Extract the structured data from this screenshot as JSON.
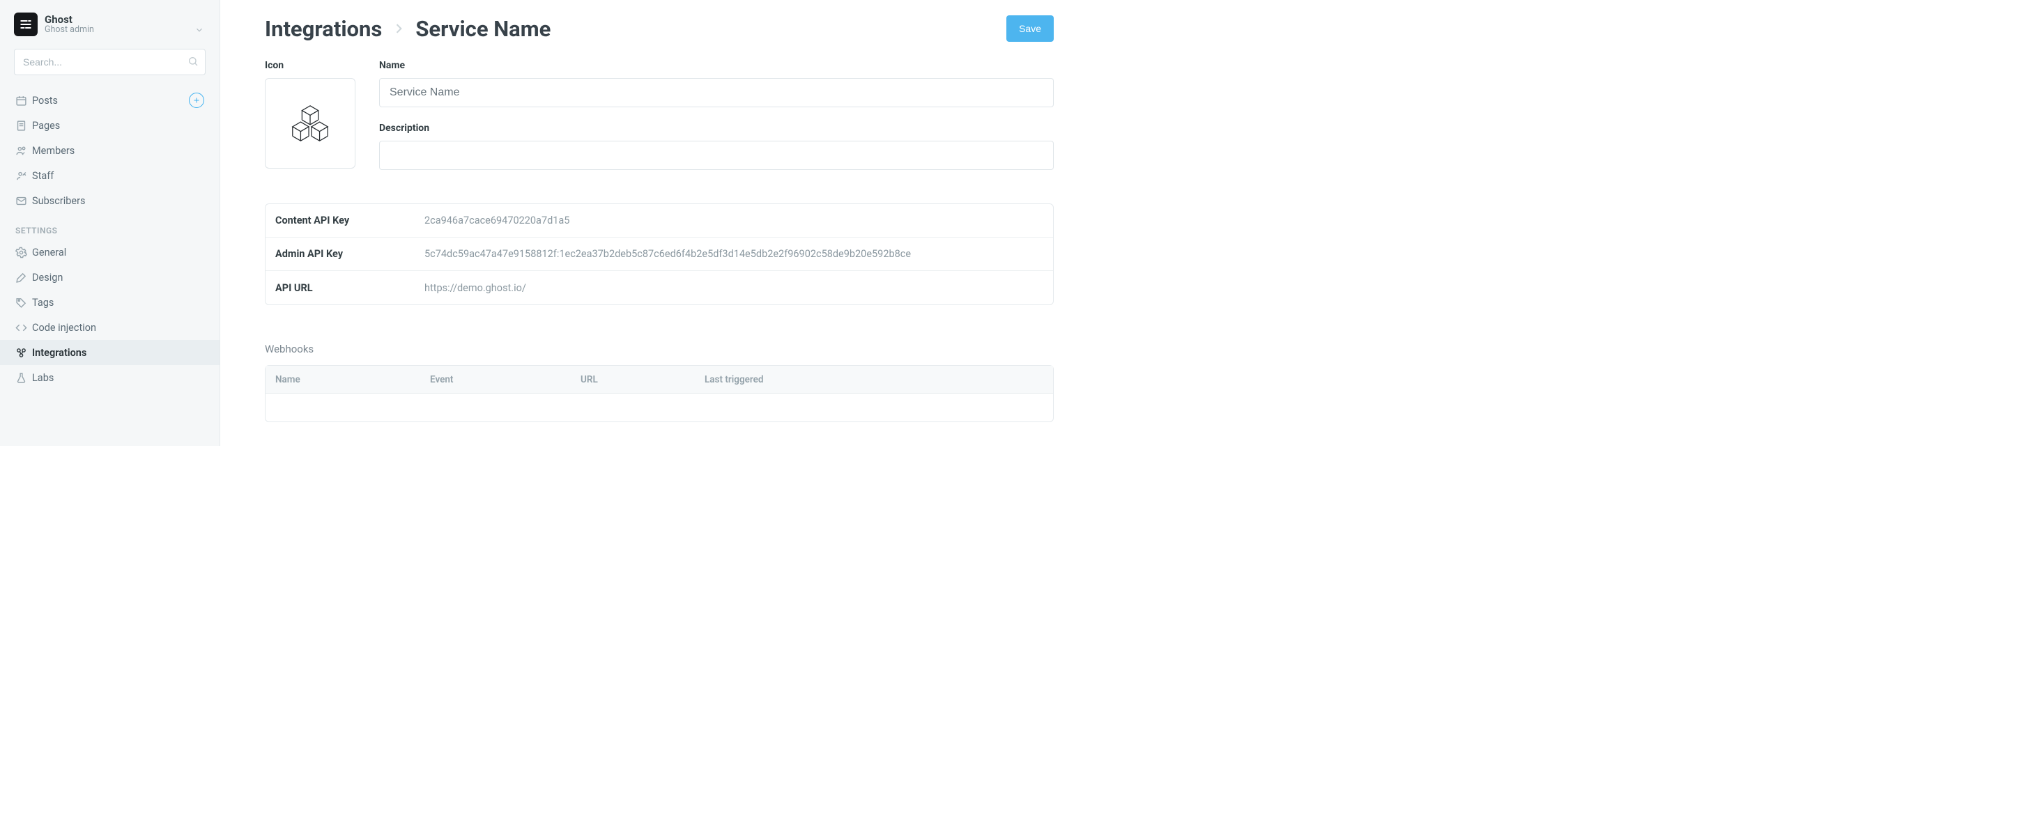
{
  "brand": {
    "title": "Ghost",
    "subtitle": "Ghost admin"
  },
  "search": {
    "placeholder": "Search..."
  },
  "nav": {
    "main": [
      {
        "label": "Posts",
        "icon": "calendar-icon",
        "add": true
      },
      {
        "label": "Pages",
        "icon": "pages-icon"
      },
      {
        "label": "Members",
        "icon": "members-icon"
      },
      {
        "label": "Staff",
        "icon": "staff-icon"
      },
      {
        "label": "Subscribers",
        "icon": "mail-icon"
      }
    ],
    "settings_label": "SETTINGS",
    "settings": [
      {
        "label": "General",
        "icon": "gear-icon"
      },
      {
        "label": "Design",
        "icon": "brush-icon"
      },
      {
        "label": "Tags",
        "icon": "tag-icon"
      },
      {
        "label": "Code injection",
        "icon": "code-icon"
      },
      {
        "label": "Integrations",
        "icon": "integrations-icon",
        "active": true
      },
      {
        "label": "Labs",
        "icon": "flask-icon"
      }
    ]
  },
  "header": {
    "breadcrumb_root": "Integrations",
    "breadcrumb_current": "Service Name",
    "save_label": "Save"
  },
  "form": {
    "icon_label": "Icon",
    "name_label": "Name",
    "name_value": "Service Name",
    "description_label": "Description",
    "description_value": ""
  },
  "api": {
    "rows": [
      {
        "label": "Content API Key",
        "value": "2ca946a7cace69470220a7d1a5"
      },
      {
        "label": "Admin API Key",
        "value": "5c74dc59ac47a47e9158812f:1ec2ea37b2deb5c87c6ed6f4b2e5df3d14e5db2e2f96902c58de9b20e592b8ce"
      },
      {
        "label": "API URL",
        "value": "https://demo.ghost.io/"
      }
    ]
  },
  "webhooks": {
    "title": "Webhooks",
    "columns": {
      "name": "Name",
      "event": "Event",
      "url": "URL",
      "last": "Last triggered"
    }
  }
}
